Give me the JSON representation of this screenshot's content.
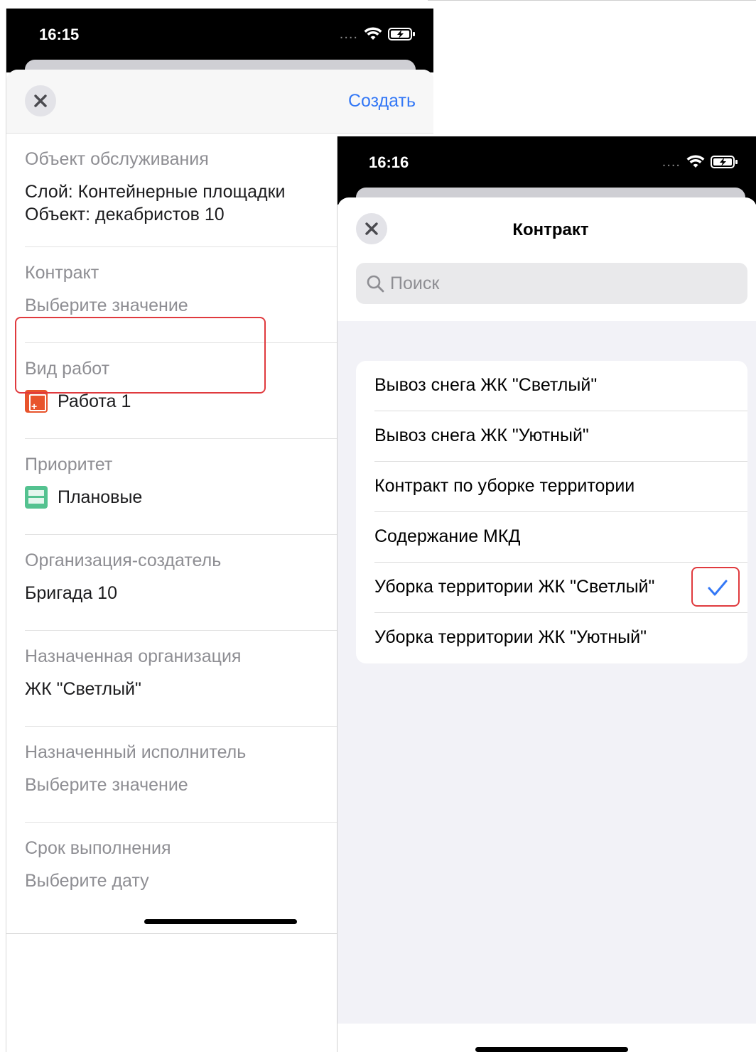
{
  "phone1": {
    "time": "16:15",
    "create_label": "Создать",
    "fields": [
      {
        "label": "Объект обслуживания",
        "value_line1": "Слой: Контейнерные площадки",
        "value_line2": "Объект: декабристов 10"
      },
      {
        "label": "Контракт",
        "value": "Выберите значение"
      },
      {
        "label": "Вид работ",
        "value": "Работа 1",
        "icon": "work-icon"
      },
      {
        "label": "Приоритет",
        "value": "Плановые",
        "icon": "priority-icon"
      },
      {
        "label": "Организация-создатель",
        "value": "Бригада 10"
      },
      {
        "label": "Назначенная организация",
        "value": "ЖК \"Светлый\""
      },
      {
        "label": "Назначенный исполнитель",
        "value": "Выберите значение"
      },
      {
        "label": "Срок выполнения",
        "value": "Выберите дату"
      }
    ]
  },
  "phone2": {
    "time": "16:16",
    "title": "Контракт",
    "search_placeholder": "Поиск",
    "items": [
      {
        "label": "Вывоз снега ЖК \"Светлый\"",
        "selected": false
      },
      {
        "label": "Вывоз снега ЖК \"Уютный\"",
        "selected": false
      },
      {
        "label": "Контракт по уборке территории",
        "selected": false
      },
      {
        "label": "Содержание МКД",
        "selected": false
      },
      {
        "label": "Уборка территории ЖК \"Светлый\"",
        "selected": true
      },
      {
        "label": "Уборка территории ЖК \"Уютный\"",
        "selected": false
      }
    ]
  },
  "colors": {
    "accent": "#3478f6",
    "highlight": "#e03a3e",
    "secondary_text": "#8e8e93"
  }
}
